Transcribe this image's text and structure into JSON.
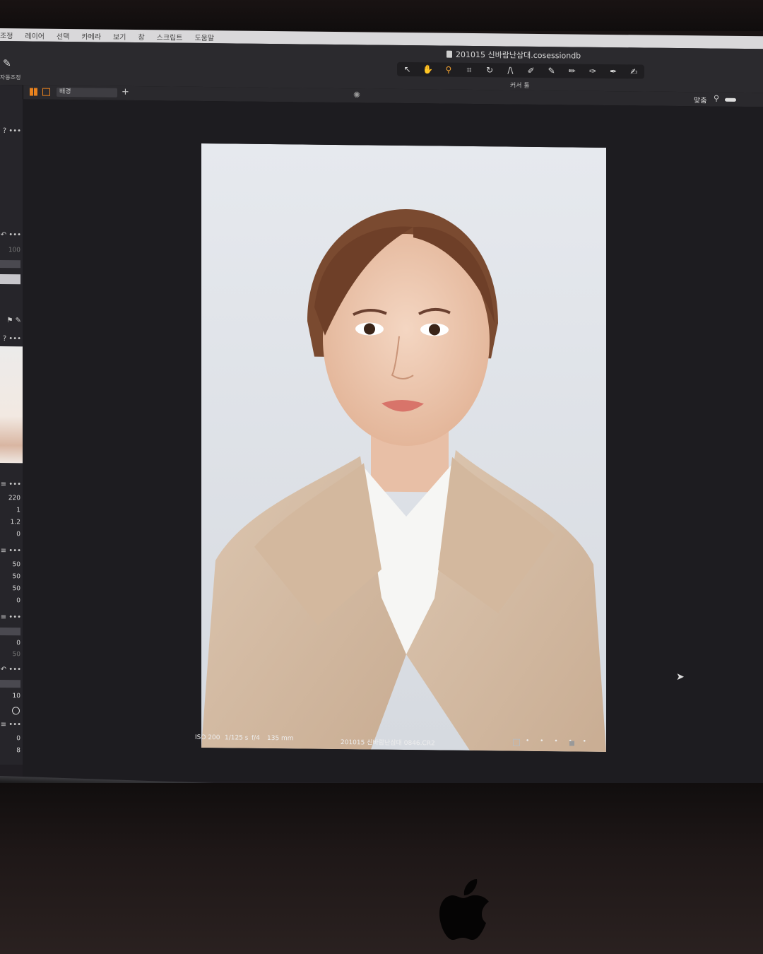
{
  "menu": {
    "items": [
      "조정",
      "레이어",
      "선택",
      "카메라",
      "보기",
      "창",
      "스크립트",
      "도움말"
    ]
  },
  "toolbar": {
    "auto_adjust_label": "자동조정",
    "document_title": "201015 신바람난삼대.cosessiondb",
    "tools_label": "커서 툴",
    "tool_icons": [
      "cursor-icon",
      "pan-hand-icon",
      "zoom-icon",
      "crop-icon",
      "rotate-icon",
      "keystone-icon",
      "brush-icon",
      "eraser-icon",
      "pen-icon",
      "mask-draw-icon",
      "picker-icon",
      "annotate-icon"
    ]
  },
  "viewbar": {
    "view_select": "배경",
    "fit_label": "맞춤"
  },
  "sidebar": {
    "values": [
      "100",
      "220",
      "1",
      "1.2",
      "0",
      "50",
      "50",
      "50",
      "0",
      "0",
      "50",
      "10",
      "0",
      "8"
    ]
  },
  "photo": {
    "iso": "ISO 200",
    "shutter": "1/125 s",
    "aperture": "f/4",
    "focal": "135 mm",
    "filename": "201015 신바람난삼대 0846.CR2",
    "rating_dots": "• • • • •"
  },
  "colors": {
    "accent": "#e8821e",
    "background": "#1d1c20",
    "panel": "#26252a"
  }
}
